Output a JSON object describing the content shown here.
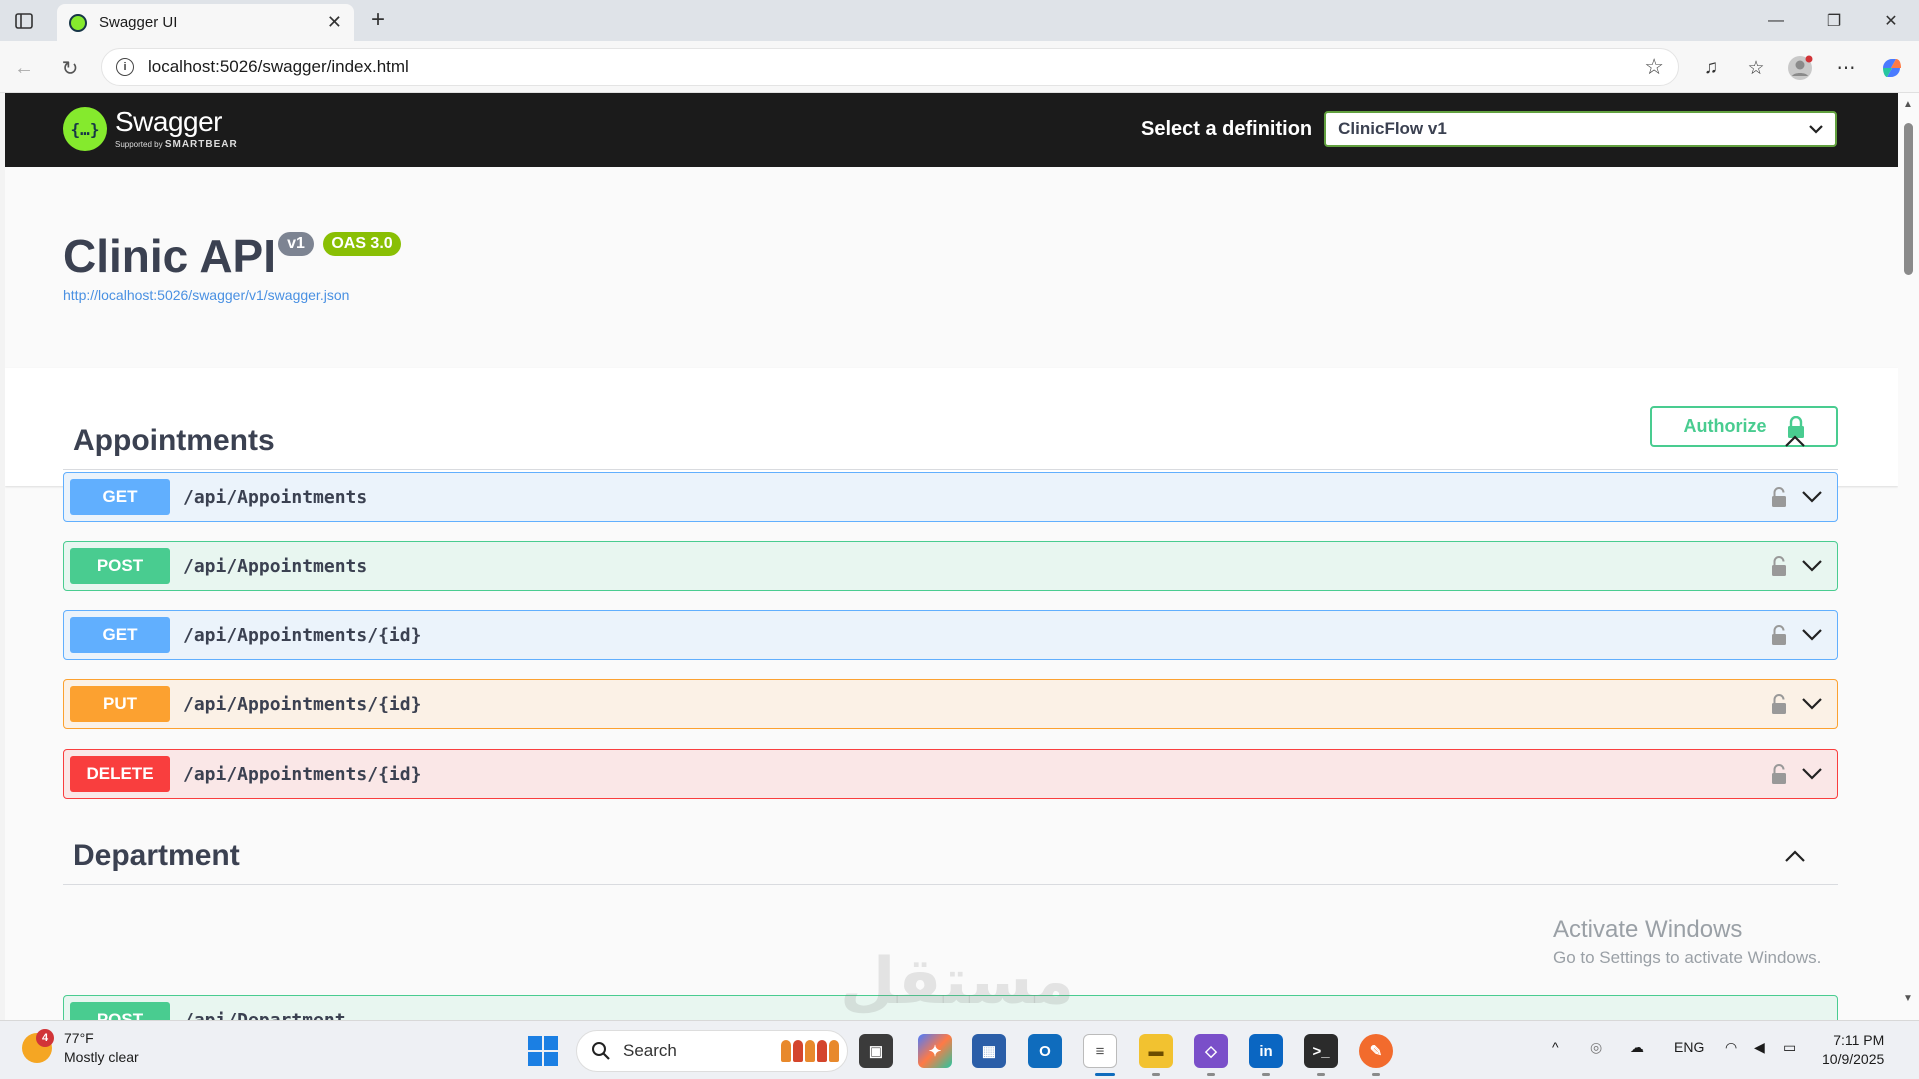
{
  "browser": {
    "tab_title": "Swagger UI",
    "url": "localhost:5026/swagger/index.html"
  },
  "swagger": {
    "brand": "Swagger",
    "supported_by": "Supported by",
    "smartbear": "SMARTBEAR",
    "select_label": "Select a definition",
    "selected_definition": "ClinicFlow v1",
    "api_title": "Clinic API",
    "version_badge": "v1",
    "oas_badge": "OAS 3.0",
    "spec_url": "http://localhost:5026/swagger/v1/swagger.json",
    "authorize_label": "Authorize",
    "tags": [
      {
        "name": "Appointments",
        "operations": [
          {
            "method": "GET",
            "path": "/api/Appointments"
          },
          {
            "method": "POST",
            "path": "/api/Appointments"
          },
          {
            "method": "GET",
            "path": "/api/Appointments/{id}"
          },
          {
            "method": "PUT",
            "path": "/api/Appointments/{id}"
          },
          {
            "method": "DELETE",
            "path": "/api/Appointments/{id}"
          }
        ]
      },
      {
        "name": "Department",
        "operations": [
          {
            "method": "POST",
            "path": "/api/Department"
          }
        ]
      }
    ]
  },
  "overlay": {
    "activate_title": "Activate Windows",
    "activate_sub": "Go to Settings to activate Windows.",
    "watermark": "مستقل"
  },
  "taskbar": {
    "weather_badge": "4",
    "temperature": "77°F",
    "condition": "Mostly clear",
    "search_label": "Search",
    "language": "ENG",
    "time": "7:11 PM",
    "date": "10/9/2025"
  },
  "colors": {
    "get": "#61affe",
    "post": "#49cc90",
    "put": "#fca130",
    "delete": "#f93e3e",
    "swagger_green": "#85ea2d"
  }
}
